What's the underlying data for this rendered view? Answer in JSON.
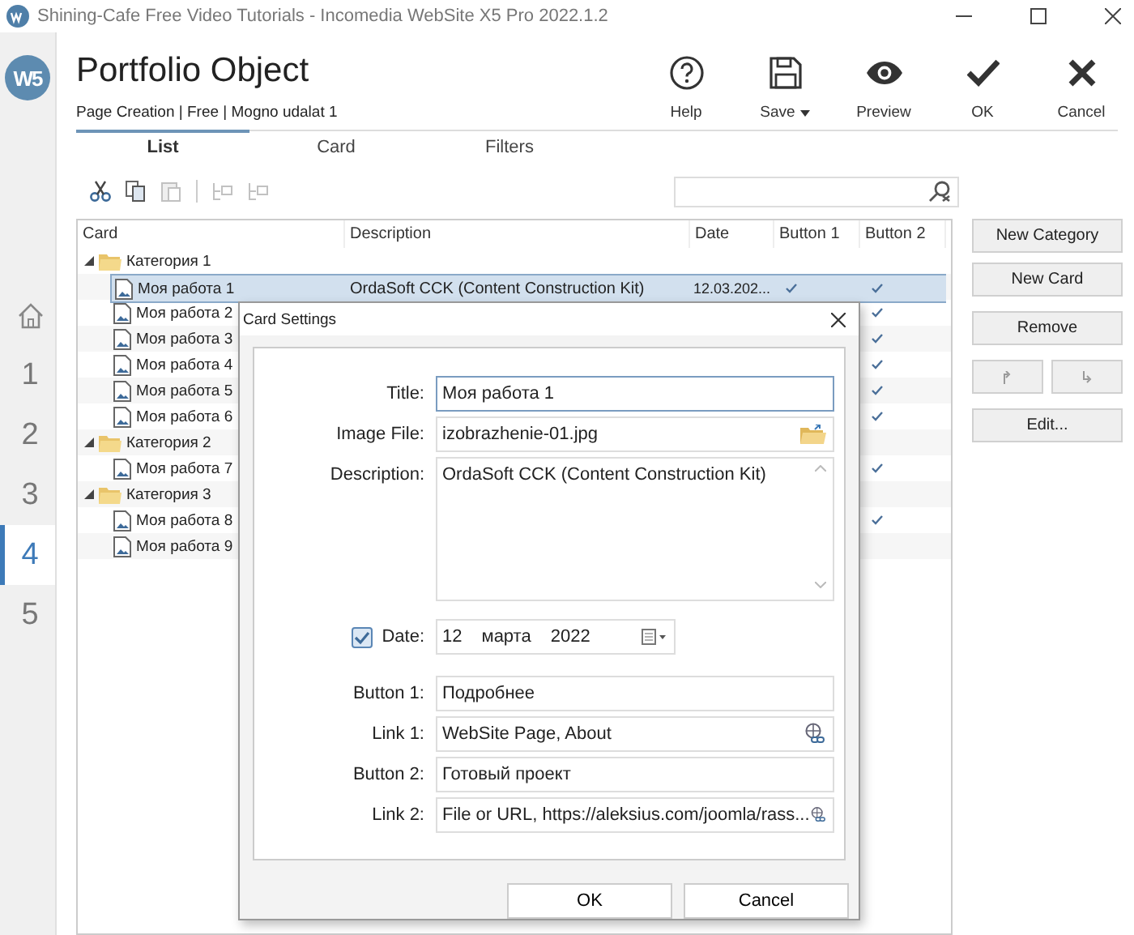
{
  "window": {
    "title": "Shining-Cafe Free Video Tutorials - Incomedia WebSite X5 Pro 2022.1.2"
  },
  "sidebar": {
    "logo_text": "W5",
    "items": [
      {
        "kind": "home",
        "selected": false
      },
      {
        "kind": "step",
        "label": "1",
        "selected": false
      },
      {
        "kind": "step",
        "label": "2",
        "selected": false
      },
      {
        "kind": "step",
        "label": "3",
        "selected": false
      },
      {
        "kind": "step",
        "label": "4",
        "selected": true
      },
      {
        "kind": "step",
        "label": "5",
        "selected": false
      }
    ]
  },
  "header": {
    "title": "Portfolio Object",
    "subtitle": "Page Creation | Free | Mogno udalat 1",
    "actions": [
      {
        "kind": "help",
        "label": "Help",
        "dropdown": false
      },
      {
        "kind": "save",
        "label": "Save",
        "dropdown": true
      },
      {
        "kind": "preview",
        "label": "Preview",
        "dropdown": false
      },
      {
        "kind": "ok",
        "label": "OK",
        "dropdown": false
      },
      {
        "kind": "cancel",
        "label": "Cancel",
        "dropdown": false
      }
    ]
  },
  "tabs": [
    {
      "label": "List",
      "selected": true
    },
    {
      "label": "Card",
      "selected": false
    },
    {
      "label": "Filters",
      "selected": false
    }
  ],
  "toolbar": [
    {
      "kind": "cut",
      "disabled": false
    },
    {
      "kind": "copy",
      "disabled": false
    },
    {
      "kind": "paste",
      "disabled": true
    },
    {
      "kind": "indent",
      "disabled": true
    },
    {
      "kind": "outdent",
      "disabled": true
    }
  ],
  "table": {
    "columns": [
      "Card",
      "Description",
      "Date",
      "Button 1",
      "Button 2"
    ],
    "categories": [
      {
        "name": "Категория 1",
        "expanded": true,
        "children": [
          {
            "name": "Моя работа 1",
            "description": "OrdaSoft CCK (Content Construction Kit)",
            "date": "12.03.202...",
            "button_1": true,
            "button_2": true,
            "selected": true
          },
          {
            "name": "Моя работа 2",
            "button_2": true,
            "selected": false
          },
          {
            "name": "Моя работа 3",
            "button_2": true,
            "selected": false
          },
          {
            "name": "Моя работа 4",
            "button_2": true,
            "selected": false
          },
          {
            "name": "Моя работа 5",
            "button_2": true,
            "selected": false
          },
          {
            "name": "Моя работа 6",
            "button_2": true,
            "selected": false
          }
        ]
      },
      {
        "name": "Категория 2",
        "expanded": true,
        "children": [
          {
            "name": "Моя работа 7",
            "button_2": true,
            "selected": false
          }
        ]
      },
      {
        "name": "Категория 3",
        "expanded": true,
        "children": [
          {
            "name": "Моя работа 8",
            "button_2": true,
            "selected": false
          },
          {
            "name": "Моя работа 9",
            "button_2": false,
            "selected": false
          }
        ]
      }
    ]
  },
  "side_buttons": [
    {
      "kind": "text",
      "label": "New Category",
      "disabled": false
    },
    {
      "kind": "text",
      "label": "New Card",
      "disabled": false
    },
    {
      "kind": "text",
      "label": "Remove",
      "disabled": false
    },
    {
      "kind": "move",
      "disabled": true
    },
    {
      "kind": "text",
      "label": "Edit...",
      "disabled": false
    }
  ],
  "dialog": {
    "title": "Card Settings",
    "fields": [
      {
        "kind": "text",
        "label": "Title:",
        "value": "Моя работа 1",
        "focused": true
      },
      {
        "kind": "browse",
        "label": "Image File:",
        "value": "izobrazhenie-01.jpg",
        "focused": false
      },
      {
        "kind": "textarea",
        "label": "Description:",
        "value": "OrdaSoft CCK (Content Construction Kit)"
      },
      {
        "kind": "date",
        "label": "Date:",
        "checked": true,
        "day": "12",
        "month": "марта",
        "year": "2022"
      },
      {
        "kind": "text",
        "label": "Button 1:",
        "value": "Подробнее",
        "focused": false
      },
      {
        "kind": "link",
        "label": "Link 1:",
        "value": "WebSite Page, About",
        "focused": false
      },
      {
        "kind": "text",
        "label": "Button 2:",
        "value": "Готовый проект",
        "focused": false
      },
      {
        "kind": "link",
        "label": "Link 2:",
        "value": "File or URL, https://aleksius.com/joomla/rass...",
        "focused": false
      }
    ],
    "buttons": [
      "OK",
      "Cancel"
    ]
  }
}
